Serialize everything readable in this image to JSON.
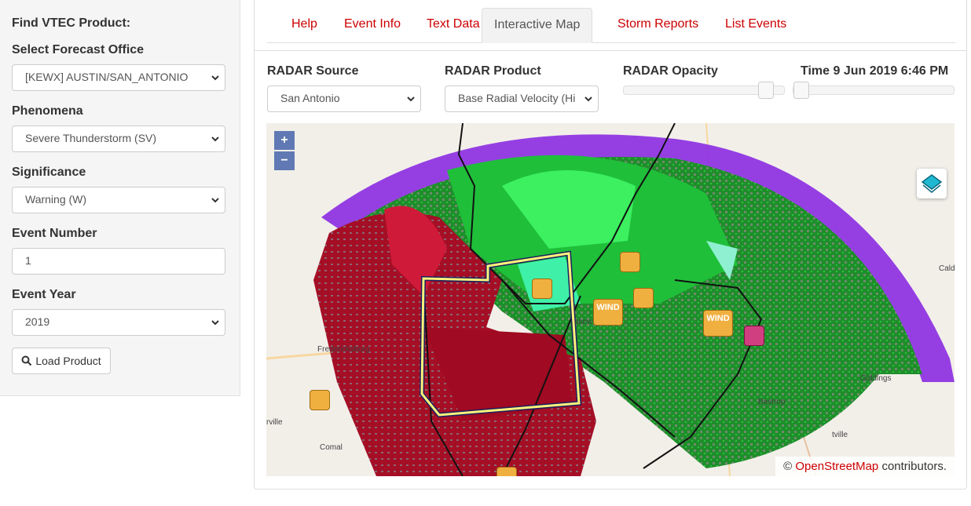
{
  "sidebar": {
    "title": "Find VTEC Product:",
    "office_label": "Select Forecast Office",
    "office_value": "[KEWX] AUSTIN/SAN_ANTONIO",
    "phenomena_label": "Phenomena",
    "phenomena_value": "Severe Thunderstorm (SV)",
    "significance_label": "Significance",
    "significance_value": "Warning (W)",
    "event_number_label": "Event Number",
    "event_number_value": "1",
    "event_year_label": "Event Year",
    "event_year_value": "2019",
    "load_button": "Load Product"
  },
  "tabs": [
    {
      "label": "Help"
    },
    {
      "label": "Event Info"
    },
    {
      "label": "Text Data"
    },
    {
      "label": "Interactive Map",
      "active": true
    },
    {
      "label": "Storm Reports"
    },
    {
      "label": "List Events"
    }
  ],
  "controls": {
    "radar_source_label": "RADAR Source",
    "radar_source_value": "San Antonio",
    "radar_product_label": "RADAR Product",
    "radar_product_value": "Base Radial Velocity (Hi",
    "radar_opacity_label": "RADAR Opacity",
    "radar_opacity_level": 0.93,
    "time_label": "Time 9 Jun 2019 6:46 PM",
    "time_slider_level": 0.0
  },
  "map": {
    "zoom_in": "+",
    "zoom_out": "−",
    "attribution_prefix": "©",
    "attribution_link": "OpenStreetMap",
    "attribution_suffix": "contributors.",
    "places": [
      "Fredericksburg",
      "Caldwell",
      "Giddings",
      "Bastrop",
      "Comal",
      "rville",
      "tville",
      "akew"
    ],
    "wind_label": "WIND",
    "colors": {
      "inbound_green": "#1e9e2e",
      "bright_green": "#3cf060",
      "outbound_red": "#b0102a",
      "purple": "#8b2be2",
      "warning_polygon": "#fff27a",
      "tab_red": "#cc0000"
    }
  }
}
